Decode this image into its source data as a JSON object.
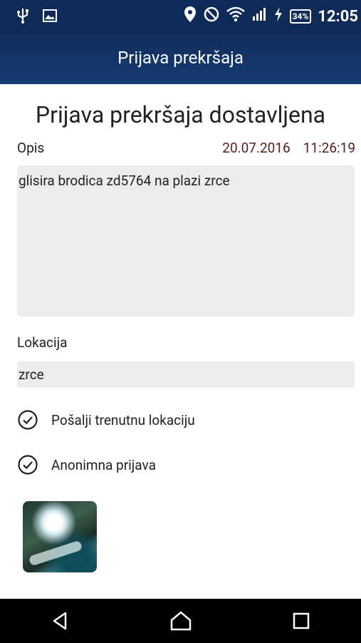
{
  "status_bar": {
    "time": "12:05",
    "battery": "34%",
    "icons": [
      "usb-icon",
      "image-icon",
      "location-pin-icon",
      "do-not-disturb-icon",
      "wifi-icon",
      "signal-icon",
      "charging-icon",
      "battery-icon"
    ]
  },
  "app_bar": {
    "title": "Prijava prekršaja"
  },
  "content": {
    "headline": "Prijava prekršaja dostavljena",
    "description_label": "Opis",
    "date": "20.07.2016",
    "time": "11:26:19",
    "description_value": "glisira brodica zd5764 na plazi zrce",
    "location_label": "Lokacija",
    "location_value": "zrce",
    "checks": [
      {
        "label": "Pošalji trenutnu lokaciju",
        "icon": "check-circle-icon"
      },
      {
        "label": "Anonimna prijava",
        "icon": "check-circle-icon"
      }
    ],
    "photo": "photo-thumbnail"
  },
  "nav_bar": {
    "buttons": [
      "back-icon",
      "home-icon",
      "recents-icon"
    ]
  }
}
